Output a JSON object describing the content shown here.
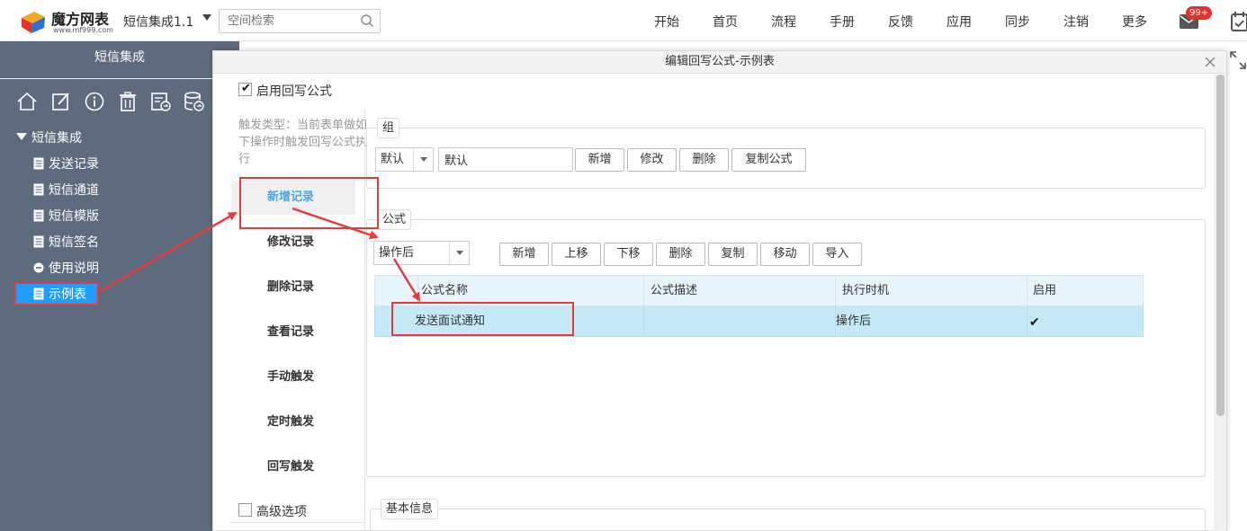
{
  "header": {
    "logo_title": "魔方网表",
    "logo_url": "www.mf999.com",
    "app_name": "短信集成1.1",
    "search_placeholder": "空间检索",
    "nav": [
      "开始",
      "首页",
      "流程",
      "手册",
      "反馈",
      "应用",
      "同步",
      "注销",
      "更多"
    ],
    "mail_badge": "99+"
  },
  "sidebar": {
    "title": "短信集成",
    "tools": [
      "home-icon",
      "edit-icon",
      "info-icon",
      "trash-icon",
      "export-icon",
      "database-icon"
    ],
    "root_label": "短信集成",
    "items": [
      {
        "label": "发送记录",
        "icon": "doc-icon"
      },
      {
        "label": "短信通道",
        "icon": "doc-icon"
      },
      {
        "label": "短信模版",
        "icon": "doc-icon"
      },
      {
        "label": "短信签名",
        "icon": "doc-icon"
      },
      {
        "label": "使用说明",
        "icon": "minus-circle-icon"
      },
      {
        "label": "示例表",
        "icon": "doc-icon",
        "active": true
      }
    ]
  },
  "dialog": {
    "title": "编辑回写公式-示例表",
    "enable_label": "启用回写公式",
    "enable_checked": true,
    "trigger_hint": "触发类型：当前表单做如下操作时触发回写公式执行",
    "trigger_tabs": [
      "新增记录",
      "修改记录",
      "删除记录",
      "查看记录",
      "手动触发",
      "定时触发",
      "回写触发"
    ],
    "active_trigger": "新增记录",
    "advanced_label": "高级选项",
    "advanced_checked": false,
    "group": {
      "legend": "组",
      "select_value": "默认",
      "name_value": "默认",
      "buttons": [
        "新增",
        "修改",
        "删除",
        "复制公式"
      ]
    },
    "formula": {
      "legend": "公式",
      "timing_value": "操作后",
      "buttons": [
        "新增",
        "上移",
        "下移",
        "删除",
        "复制",
        "移动",
        "导入"
      ],
      "columns": [
        "公式名称",
        "公式描述",
        "执行时机",
        "启用"
      ],
      "rows": [
        {
          "name": "发送面试通知",
          "desc": "",
          "timing": "操作后",
          "enabled": true
        }
      ]
    },
    "basic_info": {
      "legend": "基本信息"
    }
  },
  "colors": {
    "sidebar_bg": "#5e6a7d",
    "active_blue": "#1e9fff",
    "highlight_red": "#e43b3b",
    "selected_row": "#c6e9f8",
    "tab_active_text": "#4aa8e8"
  }
}
